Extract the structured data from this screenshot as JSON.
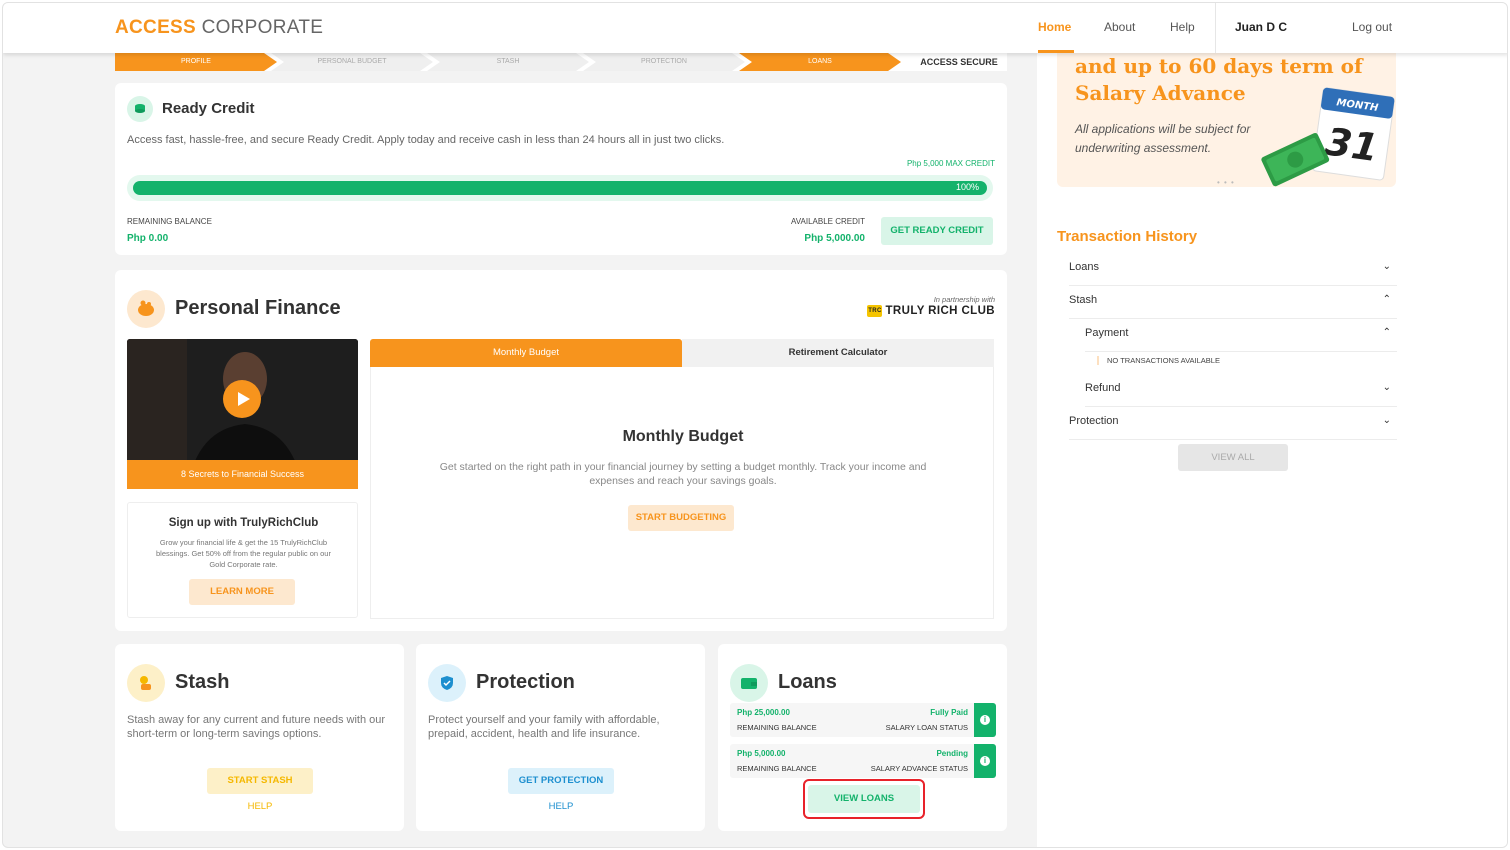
{
  "header": {
    "logo_accent": "ACCESS",
    "logo_rest": " CORPORATE",
    "nav": {
      "home": "Home",
      "about": "About",
      "help": "Help"
    },
    "user_name": "Juan D C",
    "logout": "Log out"
  },
  "steps": [
    "PROFILE",
    "PERSONAL BUDGET",
    "STASH",
    "PROTECTION",
    "LOANS",
    "ACCESS SECURE"
  ],
  "ready_credit": {
    "title": "Ready Credit",
    "description": "Access fast, hassle-free, and secure Ready Credit. Apply today and receive cash in less than 24 hours all in just two clicks.",
    "max_credit": "Php 5,000 MAX CREDIT",
    "progress_label": "100%",
    "progress_fraction": 1.0,
    "remaining_label": "REMAINING BALANCE",
    "remaining_value": "Php 0.00",
    "available_label": "AVAILABLE CREDIT",
    "available_value": "Php 5,000.00",
    "button": "GET READY CREDIT"
  },
  "personal_finance": {
    "title": "Personal Finance",
    "partner_text": "In partnership with",
    "partner_badge": "TRC",
    "partner_name": "TRULY RICH CLUB",
    "video_caption": "8 Secrets to Financial Success",
    "signup_title": "Sign up with TrulyRichClub",
    "signup_desc": "Grow your financial life & get the 15 TrulyRichClub blessings. Get 50% off from the regular public on our Gold Corporate rate.",
    "learn_more": "LEARN MORE",
    "tab_active": "Monthly Budget",
    "tab_inactive": "Retirement Calculator",
    "panel_title": "Monthly Budget",
    "panel_desc": "Get started on the right path in your financial journey by setting a budget monthly.  Track your income and expenses and reach your savings goals.",
    "panel_button": "START BUDGETING"
  },
  "stash": {
    "title": "Stash",
    "desc": "Stash away for any current and future needs with our short-term or long-term savings options.",
    "button": "START STASH",
    "help": "HELP"
  },
  "protection": {
    "title": "Protection",
    "desc": "Protect yourself and your family with affordable, prepaid, accident, health and life insurance.",
    "button": "GET PROTECTION",
    "help": "HELP"
  },
  "loans": {
    "title": "Loans",
    "rows": [
      {
        "amount": "Php 25,000.00",
        "amount_label": "REMAINING BALANCE",
        "status": "Fully Paid",
        "status_label": "SALARY LOAN STATUS"
      },
      {
        "amount": "Php 5,000.00",
        "amount_label": "REMAINING BALANCE",
        "status": "Pending",
        "status_label": "SALARY ADVANCE STATUS"
      }
    ],
    "button": "VIEW LOANS"
  },
  "promo": {
    "headline_1": "and up to 60 days term of",
    "headline_2": "Salary Advance",
    "note": "All applications will be subject for underwriting assessment.",
    "calendar_month": "MONTH",
    "calendar_day": "31"
  },
  "transaction_history": {
    "title": "Transaction History",
    "loans": "Loans",
    "stash": "Stash",
    "payment": "Payment",
    "empty": "NO TRANSACTIONS AVAILABLE",
    "refund": "Refund",
    "protection": "Protection",
    "view_all": "VIEW ALL"
  },
  "colors": {
    "accent": "#f7941d",
    "success": "#13b26b",
    "info": "#1d8fcf",
    "highlight": "#e8222a"
  },
  "icons": [
    "play-icon",
    "coins-icon",
    "piggy-icon",
    "shield-icon",
    "wallet-icon",
    "info-icon",
    "chevron-down-icon",
    "chevron-up-icon"
  ]
}
